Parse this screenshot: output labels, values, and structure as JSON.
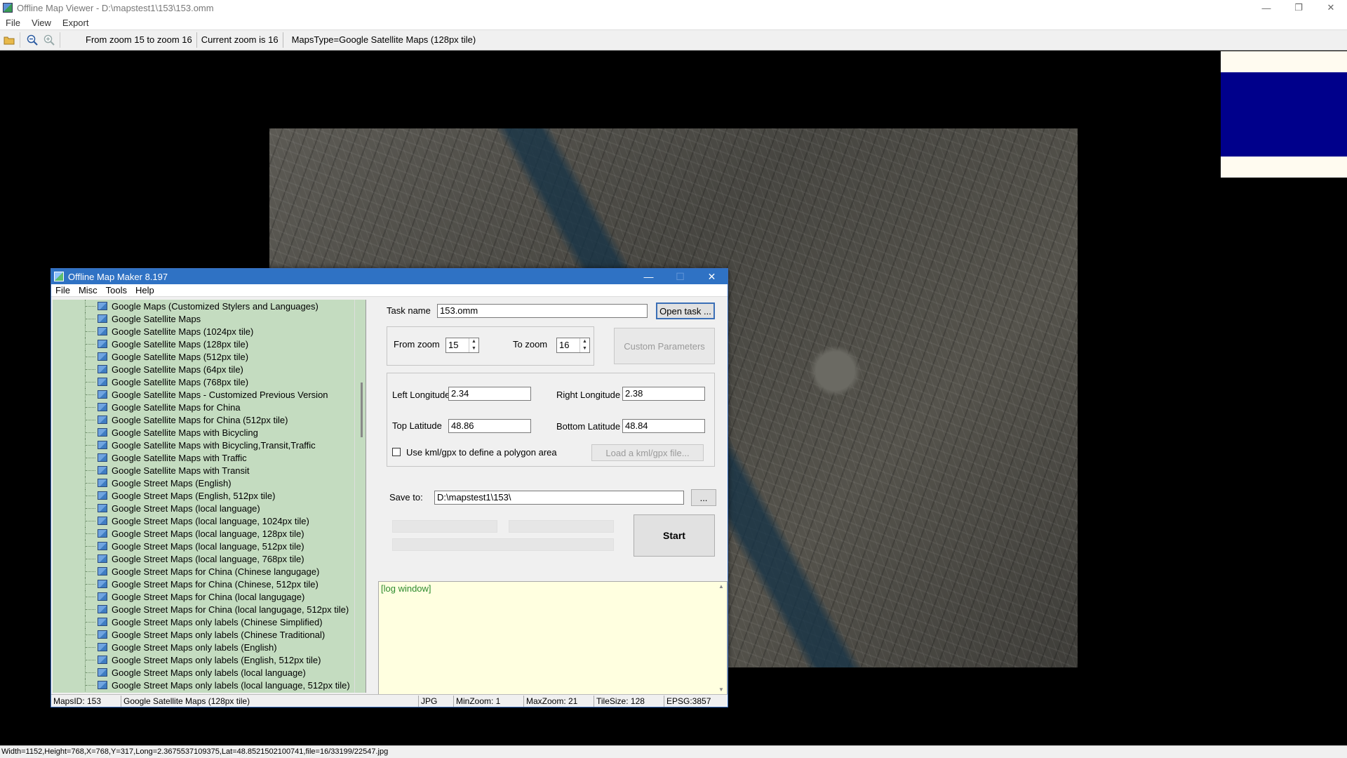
{
  "window": {
    "title": "Offline Map Viewer - D:\\mapstest1\\153\\153.omm",
    "controls": {
      "minimize": "—",
      "restore": "❐",
      "close": "✕"
    }
  },
  "menu": [
    "File",
    "View",
    "Export"
  ],
  "toolbar": {
    "icons": [
      "open-folder-icon",
      "zoom-out-icon",
      "zoom-in-icon"
    ],
    "zoom_range": "From zoom 15 to zoom 16",
    "current_zoom": "Current zoom is 16",
    "maps_type": "MapsType=Google Satellite Maps (128px tile)"
  },
  "status_bar": "Width=1152,Height=768,X=768,Y=317,Long=2.3675537109375,Lat=48.8521502100741,file=16/33199/22547.jpg",
  "dialog": {
    "title": "Offline Map Maker 8.197",
    "controls": {
      "minimize": "—",
      "maximize": "☐",
      "close": "✕"
    },
    "menu": [
      "File",
      "Misc",
      "Tools",
      "Help"
    ],
    "tree_items": [
      "Google Maps (Customized Stylers and Languages)",
      "Google Satellite Maps",
      "Google Satellite Maps (1024px tile)",
      "Google Satellite Maps (128px tile)",
      "Google Satellite Maps (512px tile)",
      "Google Satellite Maps (64px tile)",
      "Google Satellite Maps (768px tile)",
      "Google Satellite Maps - Customized Previous Version",
      "Google Satellite Maps for China",
      "Google Satellite Maps for China (512px tile)",
      "Google Satellite Maps with Bicycling",
      "Google Satellite Maps with Bicycling,Transit,Traffic",
      "Google Satellite Maps with Traffic",
      "Google Satellite Maps with Transit",
      "Google Street Maps (English)",
      "Google Street Maps (English, 512px tile)",
      "Google Street Maps (local language)",
      "Google Street Maps (local language, 1024px tile)",
      "Google Street Maps (local language, 128px tile)",
      "Google Street Maps (local language, 512px tile)",
      "Google Street Maps (local language, 768px tile)",
      "Google Street Maps for China (Chinese langugage)",
      "Google Street Maps for China (Chinese, 512px tile)",
      "Google Street Maps for China (local langugage)",
      "Google Street Maps for China (local langugage, 512px tile)",
      "Google Street Maps only labels (Chinese Simplified)",
      "Google Street Maps only labels (Chinese Traditional)",
      "Google Street Maps only labels (English)",
      "Google Street Maps only labels (English, 512px tile)",
      "Google Street Maps only labels (local language)",
      "Google Street Maps only labels (local language, 512px tile)"
    ],
    "task_name_label": "Task name",
    "task_name_value": "153.omm",
    "open_task_label": "Open task ...",
    "from_zoom_label": "From zoom",
    "from_zoom_value": "15",
    "to_zoom_label": "To zoom",
    "to_zoom_value": "16",
    "custom_params_label": "Custom Parameters",
    "left_lon_label": "Left Longitude",
    "left_lon_value": "2.34",
    "right_lon_label": "Right Longitude",
    "right_lon_value": "2.38",
    "top_lat_label": "Top Latitude",
    "top_lat_value": "48.86",
    "bottom_lat_label": "Bottom Latitude",
    "bottom_lat_value": "48.84",
    "kml_checkbox_label": "Use kml/gpx to define a polygon area",
    "load_kml_label": "Load a kml/gpx file...",
    "save_to_label": "Save to:",
    "save_to_value": "D:\\mapstest1\\153\\",
    "browse_label": "...",
    "start_label": "Start",
    "log_text": "[log window]",
    "status": {
      "maps_id": "MapsID: 153",
      "maps_name": "Google Satellite Maps (128px tile)",
      "format": "JPG",
      "min_zoom": "MinZoom: 1",
      "max_zoom": "MaxZoom: 21",
      "tile_size": "TileSize: 128",
      "epsg": "EPSG:3857"
    }
  }
}
